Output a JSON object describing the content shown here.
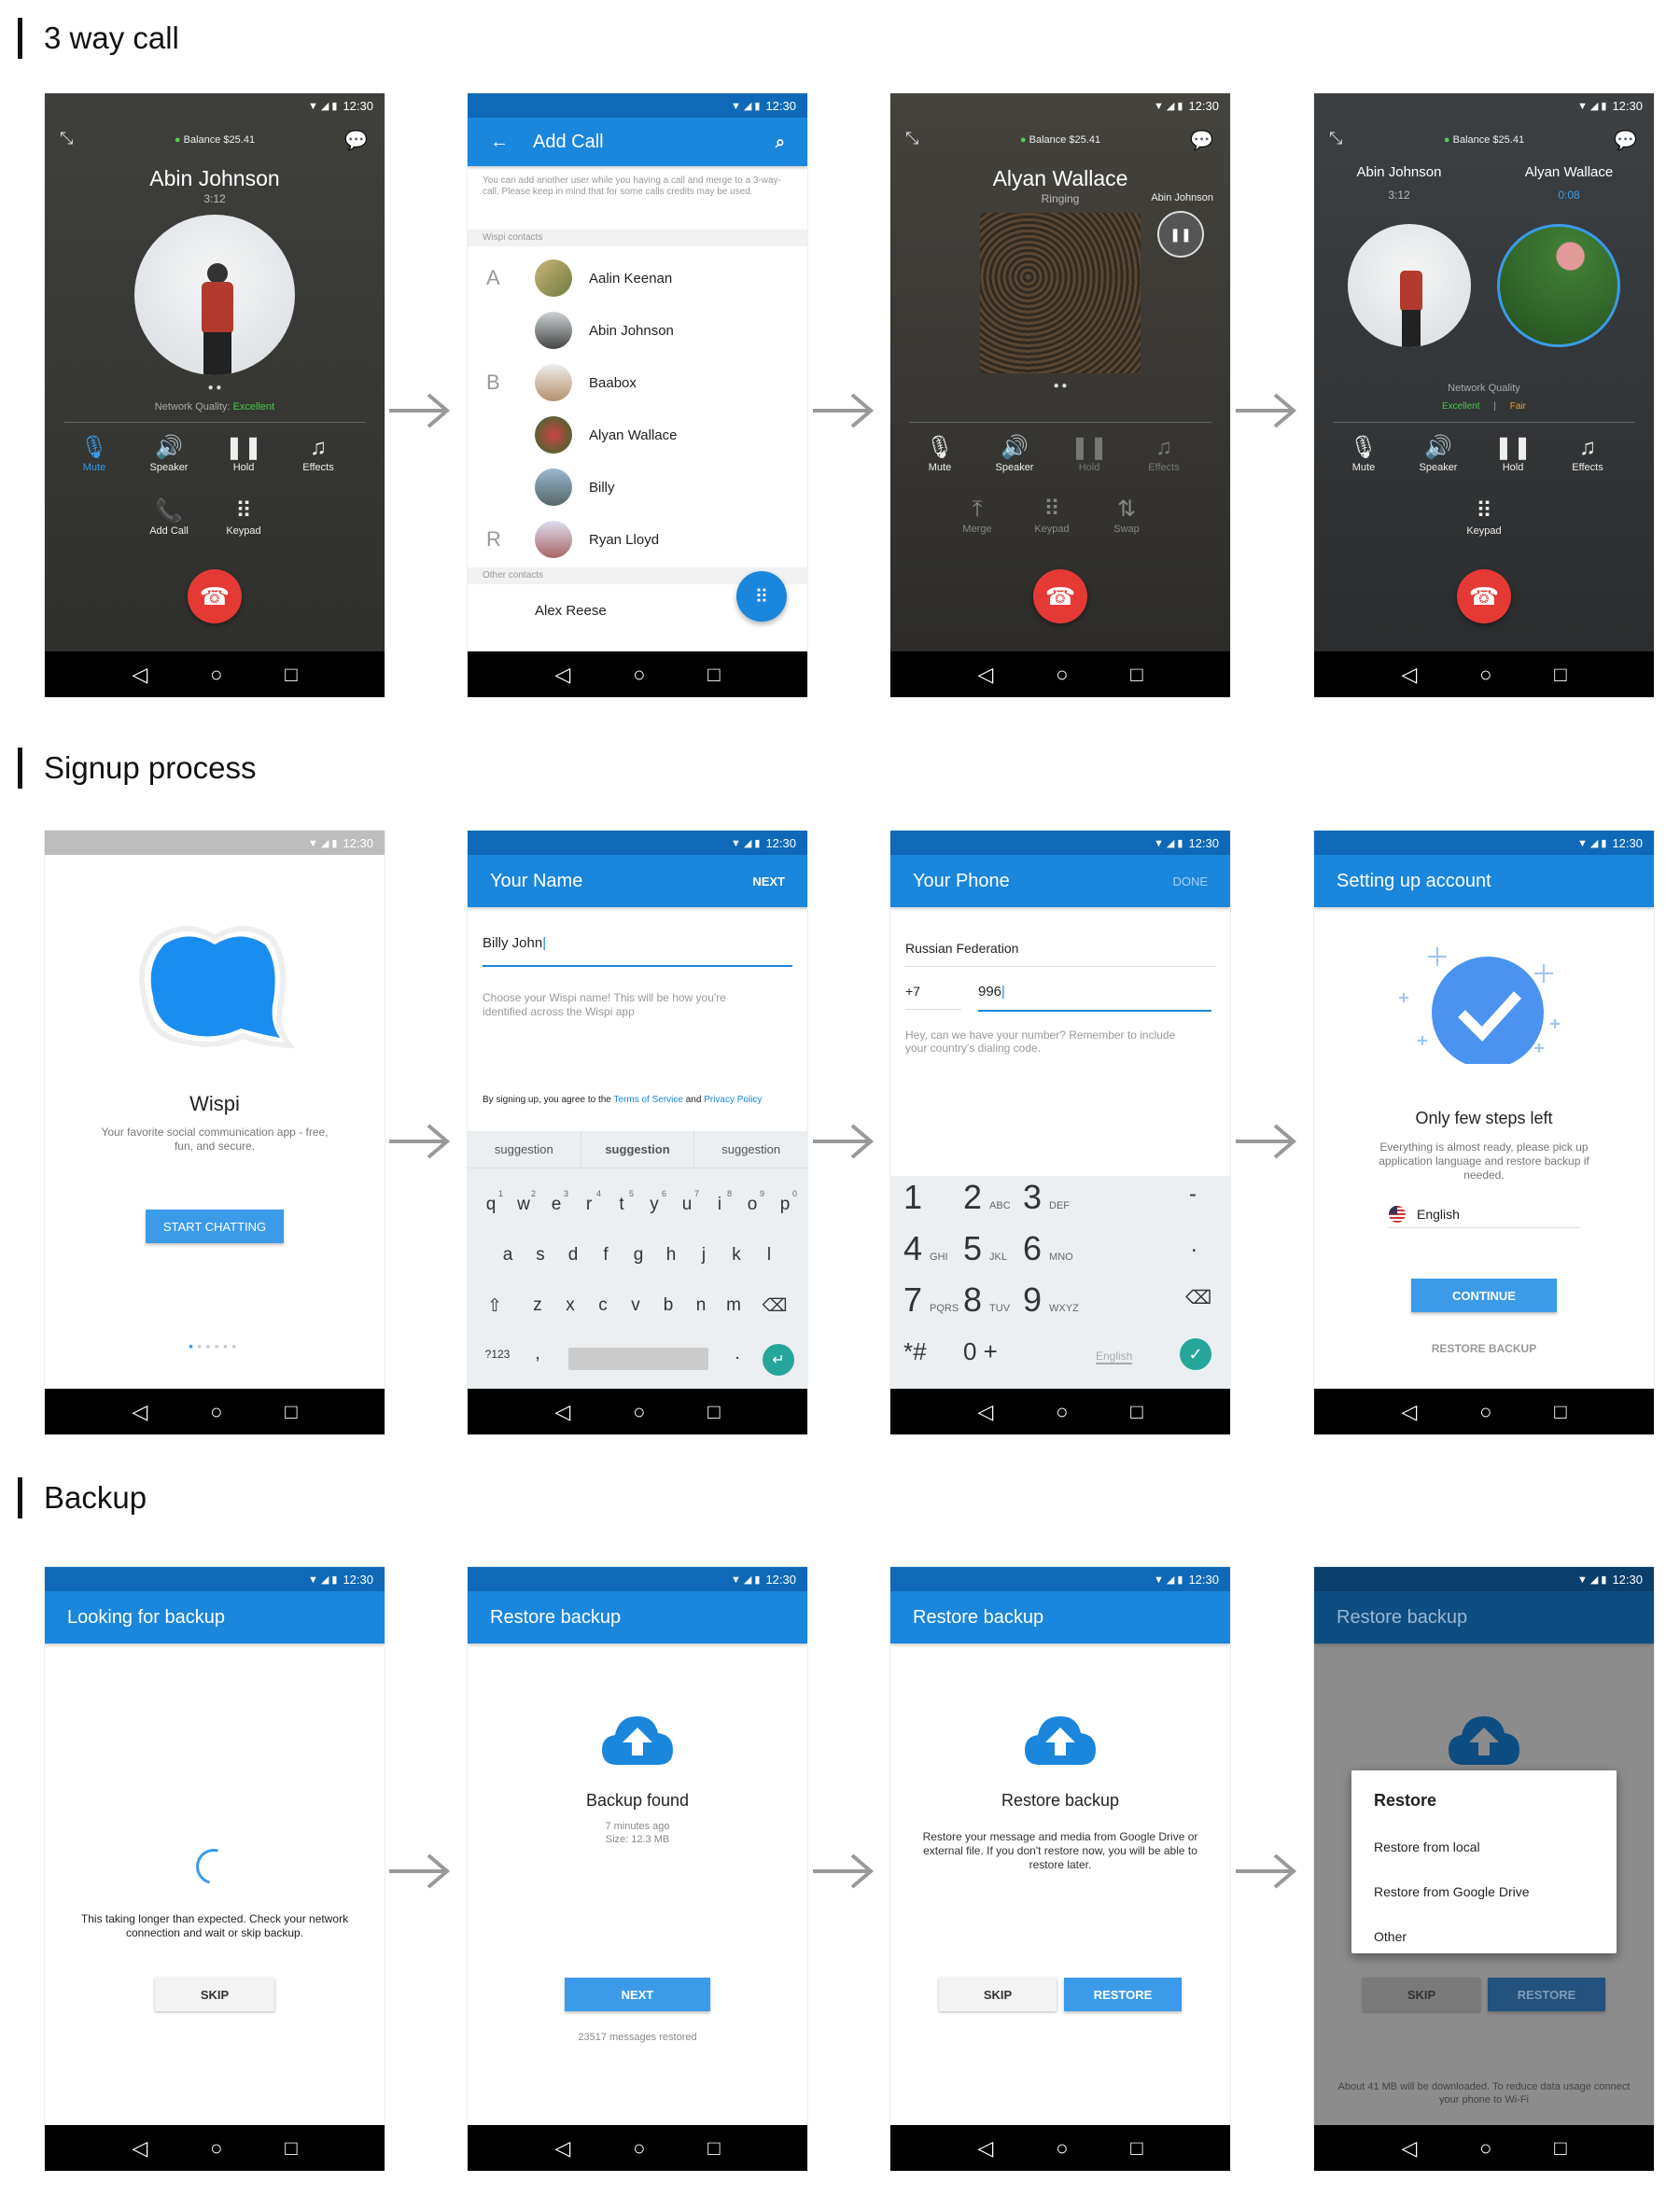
{
  "sections": {
    "call": "3 way call",
    "signup": "Signup process",
    "backup": "Backup"
  },
  "status": {
    "time": "12:30"
  },
  "call1": {
    "balance": "Balance $25.41",
    "name": "Abin Johnson",
    "duration": "3:12",
    "quality_label": "Network Quality:",
    "quality_value": "Excellent",
    "mute": "Mute",
    "speaker": "Speaker",
    "hold": "Hold",
    "effects": "Effects",
    "add_call": "Add Call",
    "keypad": "Keypad"
  },
  "addcall": {
    "title": "Add Call",
    "info": "You can add another user while you having a call and merge to a 3-way-call. Please keep in mind that for some calls credits may be used.",
    "group1": "Wispi contacts",
    "group2": "Other contacts",
    "letters": [
      "A",
      "B",
      "R"
    ],
    "contacts": [
      "Aalin Keenan",
      "Abin Johnson",
      "Baabox",
      "Alyan Wallace",
      "Billy",
      "Ryan Lloyd"
    ],
    "other": "Alex Reese"
  },
  "call3": {
    "balance": "Balance $25.41",
    "name": "Alyan Wallace",
    "state": "Ringing",
    "held_name": "Abin Johnson",
    "mute": "Mute",
    "speaker": "Speaker",
    "hold": "Hold",
    "effects": "Effects",
    "merge": "Merge",
    "keypad": "Keypad",
    "swap": "Swap"
  },
  "call4": {
    "balance": "Balance $25.41",
    "name1": "Abin Johnson",
    "time1": "3:12",
    "name2": "Alyan Wallace",
    "time2": "0:08",
    "quality_label": "Network Quality",
    "q1": "Excellent",
    "q2": "Fair",
    "mute": "Mute",
    "speaker": "Speaker",
    "hold": "Hold",
    "effects": "Effects",
    "keypad": "Keypad"
  },
  "welcome": {
    "app": "Wispi",
    "tagline": "Your favorite social communication app - free, fun, and secure.",
    "button": "START CHATTING"
  },
  "name": {
    "title": "Your Name",
    "action": "NEXT",
    "value": "Billy John",
    "hint": "Choose your Wispi name! This will be how you're identified across the Wispi app",
    "terms_pre": "By signing up, you agree to the ",
    "terms_link": "Terms of Service",
    "terms_and": " and ",
    "privacy": "Privacy Policy",
    "suggestions": [
      "suggestion",
      "suggestion",
      "suggestion"
    ],
    "row1": [
      "q",
      "w",
      "e",
      "r",
      "t",
      "y",
      "u",
      "i",
      "o",
      "p"
    ],
    "row1n": [
      "1",
      "2",
      "3",
      "4",
      "5",
      "6",
      "7",
      "8",
      "9",
      "0"
    ],
    "row2": [
      "a",
      "s",
      "d",
      "f",
      "g",
      "h",
      "j",
      "k",
      "l"
    ],
    "row3": [
      "z",
      "x",
      "c",
      "v",
      "b",
      "n",
      "m"
    ],
    "sym": "?123",
    "comma": ",",
    "dot": "."
  },
  "phone": {
    "title": "Your Phone",
    "action": "DONE",
    "country": "Russian Federation",
    "code": "+7",
    "number": "996",
    "hint": "Hey, can we have your number? Remember to include your country's dialing code.",
    "keys": [
      [
        "1",
        ""
      ],
      [
        "2",
        "ABC"
      ],
      [
        "3",
        "DEF"
      ],
      [
        "4",
        "GHI"
      ],
      [
        "5",
        "JKL"
      ],
      [
        "6",
        "MNO"
      ],
      [
        "7",
        "PQRS"
      ],
      [
        "8",
        "TUV"
      ],
      [
        "9",
        "WXYZ"
      ],
      [
        "*#",
        ""
      ],
      [
        "0 +",
        ""
      ]
    ],
    "lang": "English",
    "dash": "-",
    "dot": "."
  },
  "setup": {
    "title": "Setting up account",
    "heading": "Only few steps left",
    "text": "Everything is almost ready, please pick up application language and restore backup if needed.",
    "language": "English",
    "button": "CONTINUE",
    "restore": "RESTORE BACKUP"
  },
  "look": {
    "title": "Looking for backup",
    "text": "This taking longer than expected. Check your network connection and wait or skip backup.",
    "skip": "SKIP"
  },
  "found": {
    "title": "Restore backup",
    "heading": "Backup found",
    "ago": "7 minutes ago",
    "size": "Size: 12.3 MB",
    "next": "NEXT",
    "restored": "23517 messages restored"
  },
  "restore": {
    "title": "Restore backup",
    "heading": "Restore backup",
    "text": "Restore your message and media from Google Drive or external file. If you don't restore now, you will be able to restore later.",
    "skip": "SKIP",
    "restore": "RESTORE"
  },
  "dialog": {
    "title": "Restore backup",
    "dlg_title": "Restore",
    "opt1": "Restore from local",
    "opt2": "Restore from Google Drive",
    "opt3": "Other",
    "skip": "SKIP",
    "restore": "RESTORE",
    "footer": "About 41 MB will be downloaded. To reduce data usage connect your phone to Wi-Fi"
  }
}
